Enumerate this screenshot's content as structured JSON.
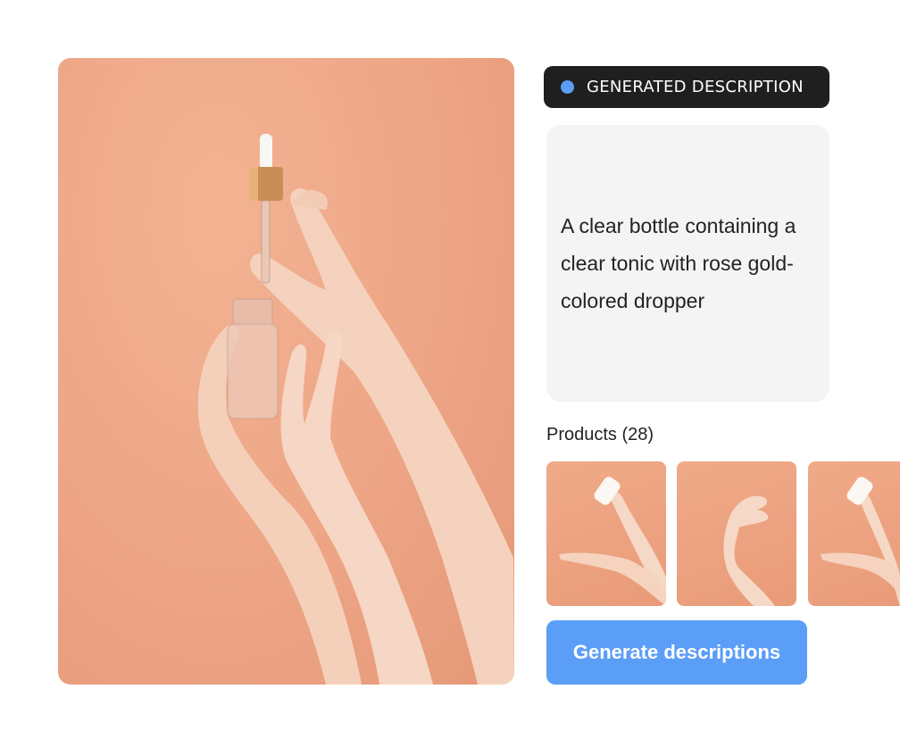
{
  "badge": {
    "label": "GENERATED DESCRIPTION",
    "dot_color": "#5b9ef7",
    "icon": "status-dot-icon"
  },
  "description": {
    "text": "A clear bottle containing a clear tonic with rose gold-colored dropper"
  },
  "products": {
    "label": "Products (28)",
    "thumbnails": [
      {
        "name": "product-thumbnail-1"
      },
      {
        "name": "product-thumbnail-2"
      },
      {
        "name": "product-thumbnail-3"
      }
    ]
  },
  "cta": {
    "label": "Generate descriptions",
    "color": "#5b9ef7"
  },
  "colors": {
    "background_peach": "#eda585",
    "skin": "#f6d6c4",
    "dark": "#1f1f1f",
    "card_gray": "#f4f4f4"
  }
}
